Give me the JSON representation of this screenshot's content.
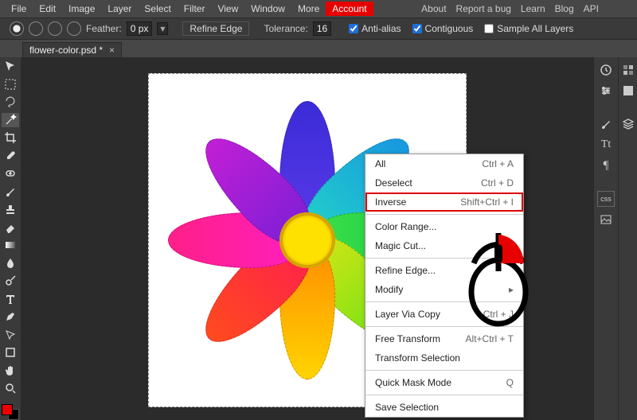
{
  "menubar": {
    "items": [
      "File",
      "Edit",
      "Image",
      "Layer",
      "Select",
      "Filter",
      "View",
      "Window",
      "More"
    ],
    "account": "Account",
    "help": [
      "About",
      "Report a bug",
      "Learn",
      "Blog",
      "API"
    ]
  },
  "options": {
    "feather_label": "Feather:",
    "feather_value": "0 px",
    "refine_edge": "Refine Edge",
    "tolerance_label": "Tolerance:",
    "tolerance_value": "16",
    "anti_alias": "Anti-alias",
    "contiguous": "Contiguous",
    "sample_all": "Sample All Layers"
  },
  "doc_tab": {
    "name": "flower-color.psd *",
    "close": "×"
  },
  "context_menu": {
    "items": [
      {
        "label": "All",
        "shortcut": "Ctrl + A"
      },
      {
        "label": "Deselect",
        "shortcut": "Ctrl + D"
      },
      {
        "label": "Inverse",
        "shortcut": "Shift+Ctrl + I",
        "highlight": true
      },
      {
        "sep": true
      },
      {
        "label": "Color Range..."
      },
      {
        "label": "Magic Cut..."
      },
      {
        "sep": true
      },
      {
        "label": "Refine Edge..."
      },
      {
        "label": "Modify",
        "shortcut": "▸"
      },
      {
        "sep": true
      },
      {
        "label": "Layer Via Copy",
        "shortcut": "Ctrl + J"
      },
      {
        "sep": true
      },
      {
        "label": "Free Transform",
        "shortcut": "Alt+Ctrl + T"
      },
      {
        "label": "Transform Selection"
      },
      {
        "sep": true
      },
      {
        "label": "Quick Mask Mode",
        "shortcut": "Q"
      },
      {
        "sep": true
      },
      {
        "label": "Save Selection"
      }
    ]
  },
  "tools": [
    "move",
    "rect-select",
    "lasso",
    "magic-wand",
    "crop",
    "eyedropper",
    "healing",
    "brush",
    "stamp",
    "eraser",
    "gradient",
    "blur",
    "dodge",
    "pen",
    "type",
    "path-select",
    "rectangle",
    "hand",
    "zoom"
  ],
  "right_panels": [
    "history",
    "swatches",
    "adjustments",
    "properties",
    "brushes",
    "layers",
    "type-panel",
    "paragraph",
    "css",
    "image-assets"
  ],
  "swatches": {
    "fg": "#ee0000",
    "bg": "#000000"
  }
}
